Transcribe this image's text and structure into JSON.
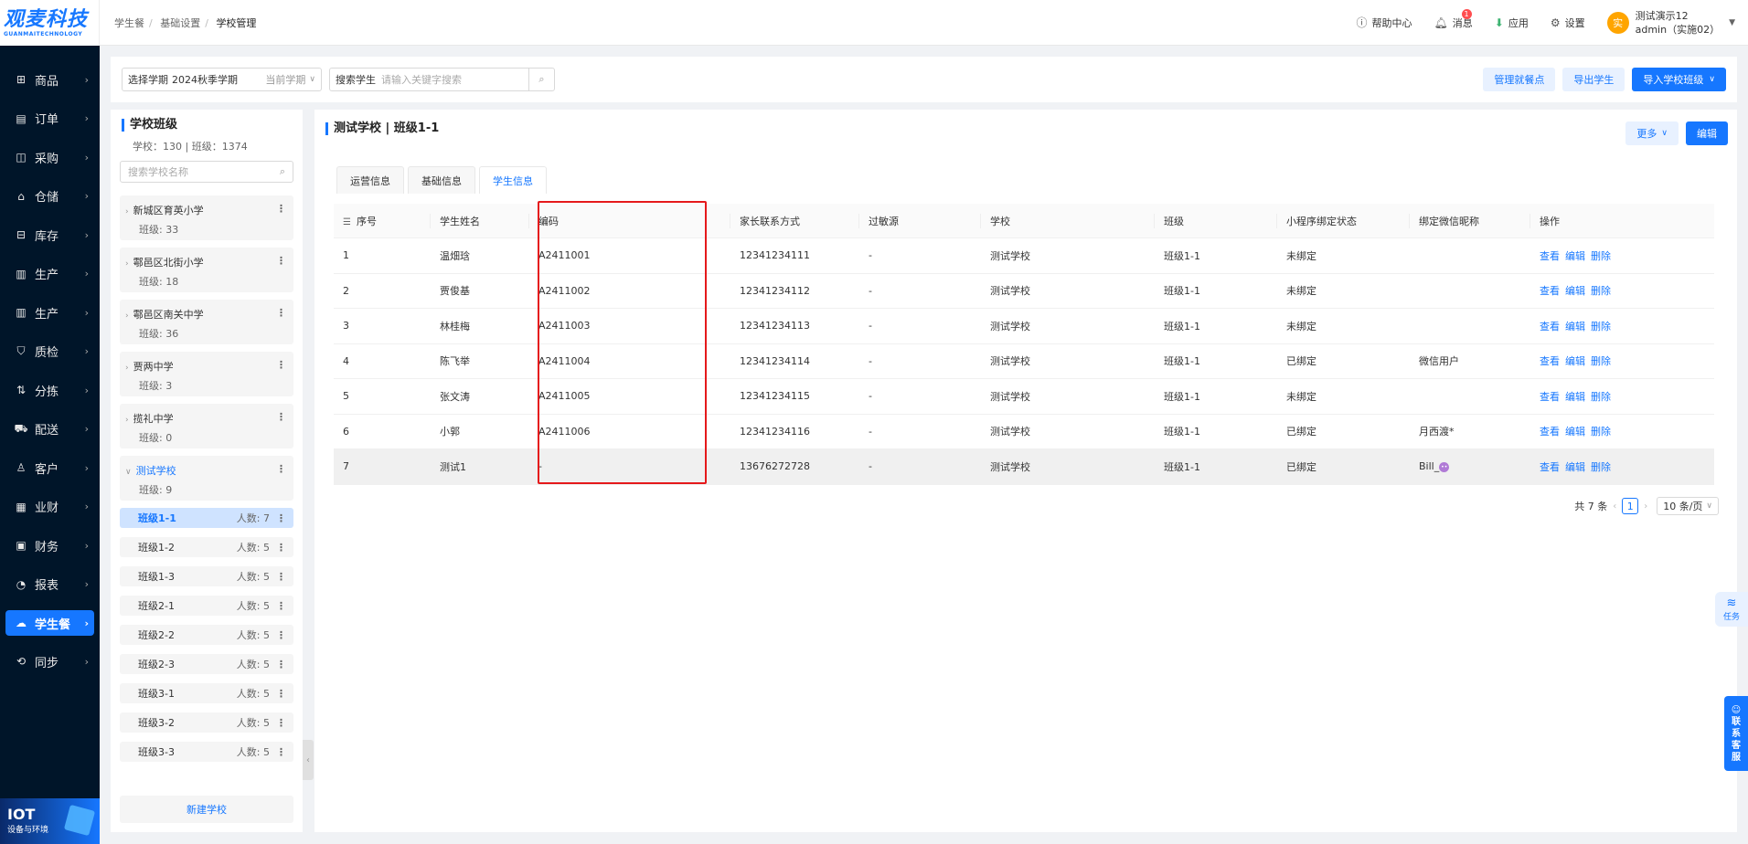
{
  "logo": {
    "title": "观麦科技",
    "subtitle": "GUANMAITECHNOLOGY"
  },
  "menu": [
    {
      "label": "商品",
      "icon": "grid-icon"
    },
    {
      "label": "订单",
      "icon": "clipboard-icon"
    },
    {
      "label": "采购",
      "icon": "shopping-bag-icon"
    },
    {
      "label": "仓储",
      "icon": "warehouse-icon"
    },
    {
      "label": "库存",
      "icon": "inventory-icon"
    },
    {
      "label": "生产",
      "icon": "factory-icon"
    },
    {
      "label": "生产",
      "icon": "factory-icon"
    },
    {
      "label": "质检",
      "icon": "shield-icon"
    },
    {
      "label": "分拣",
      "icon": "sort-icon"
    },
    {
      "label": "配送",
      "icon": "truck-icon"
    },
    {
      "label": "客户",
      "icon": "user-icon"
    },
    {
      "label": "业财",
      "icon": "chart-icon"
    },
    {
      "label": "财务",
      "icon": "finance-icon"
    },
    {
      "label": "报表",
      "icon": "report-icon"
    },
    {
      "label": "学生餐",
      "icon": "cloud-icon"
    },
    {
      "label": "同步",
      "icon": "sync-icon"
    }
  ],
  "iot": {
    "title": "IOT",
    "subtitle": "设备与环境"
  },
  "breadcrumb": [
    "学生餐",
    "基础设置",
    "学校管理"
  ],
  "header": {
    "help": "帮助中心",
    "messages": "消息",
    "msg_badge": "1",
    "apps": "应用",
    "settings": "设置",
    "avatar": "实",
    "user_name": "测试演示12",
    "user_sub": "admin（实施02）"
  },
  "toolbar": {
    "term_label": "选择学期",
    "term_value": "2024秋季学期",
    "term_tag": "当前学期",
    "search_label": "搜索学生",
    "search_placeholder": "请输入关键字搜索",
    "btn_pickup": "管理就餐点",
    "btn_export": "导出学生",
    "btn_import": "导入学校班级"
  },
  "left": {
    "title": "学校班级",
    "stats": "学校：130  |  班级：1374",
    "search_placeholder": "搜索学校名称",
    "schools": [
      {
        "name": "新城区育英小学",
        "count": "班级: 33"
      },
      {
        "name": "鄠邑区北街小学",
        "count": "班级: 18"
      },
      {
        "name": "鄠邑区南关中学",
        "count": "班级: 36"
      },
      {
        "name": "贾两中学",
        "count": "班级: 3"
      },
      {
        "name": "揽礼中学",
        "count": "班级: 0"
      },
      {
        "name": "测试学校",
        "count": "班级: 9"
      }
    ],
    "classes": [
      {
        "name": "班级1-1",
        "count": "人数:  7"
      },
      {
        "name": "班级1-2",
        "count": "人数:  5"
      },
      {
        "name": "班级1-3",
        "count": "人数:  5"
      },
      {
        "name": "班级2-1",
        "count": "人数:  5"
      },
      {
        "name": "班级2-2",
        "count": "人数:  5"
      },
      {
        "name": "班级2-3",
        "count": "人数:  5"
      },
      {
        "name": "班级3-1",
        "count": "人数:  5"
      },
      {
        "name": "班级3-2",
        "count": "人数:  5"
      },
      {
        "name": "班级3-3",
        "count": "人数:  5"
      }
    ],
    "new_school": "新建学校"
  },
  "main": {
    "title": "测试学校 | 班级1-1",
    "btn_more": "更多",
    "btn_edit": "编辑",
    "tabs": [
      "运营信息",
      "基础信息",
      "学生信息"
    ],
    "columns": [
      "序号",
      "学生姓名",
      "编码",
      "家长联系方式",
      "过敏源",
      "学校",
      "班级",
      "小程序绑定状态",
      "绑定微信昵称",
      "操作"
    ],
    "rows": [
      [
        "1",
        "温畑琀",
        "A2411001",
        "12341234111",
        "-",
        "测试学校",
        "班级1-1",
        "未绑定",
        ""
      ],
      [
        "2",
        "贾俊基",
        "A2411002",
        "12341234112",
        "-",
        "测试学校",
        "班级1-1",
        "未绑定",
        ""
      ],
      [
        "3",
        "林桂梅",
        "A2411003",
        "12341234113",
        "-",
        "测试学校",
        "班级1-1",
        "未绑定",
        ""
      ],
      [
        "4",
        "陈飞举",
        "A2411004",
        "12341234114",
        "-",
        "测试学校",
        "班级1-1",
        "已绑定",
        "微信用户"
      ],
      [
        "5",
        "张文涛",
        "A2411005",
        "12341234115",
        "-",
        "测试学校",
        "班级1-1",
        "未绑定",
        ""
      ],
      [
        "6",
        "小郭",
        "A2411006",
        "12341234116",
        "-",
        "测试学校",
        "班级1-1",
        "已绑定",
        "月西渡*"
      ],
      [
        "7",
        "测试1",
        "-",
        "13676272728",
        "-",
        "测试学校",
        "班级1-1",
        "已绑定",
        "Bill_"
      ]
    ],
    "actions": [
      "查看",
      "编辑",
      "删除"
    ],
    "pager": {
      "total": "共 7 条",
      "page": "1",
      "size": "10 条/页"
    }
  },
  "float": {
    "task": "任务",
    "service": [
      "联",
      "系",
      "客",
      "服"
    ]
  }
}
